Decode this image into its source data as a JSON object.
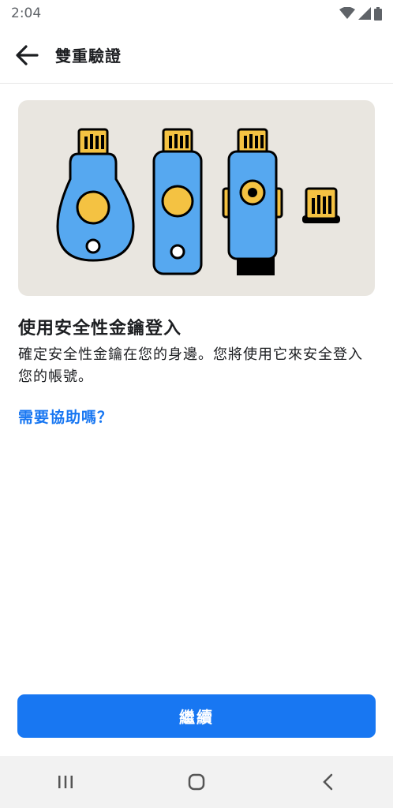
{
  "status_bar": {
    "time": "2:04"
  },
  "app_bar": {
    "title": "雙重驗證",
    "back_icon": "arrow-left-icon"
  },
  "illustration": {
    "description_icon": "security-keys-illustration"
  },
  "content": {
    "heading": "使用安全性金鑰登入",
    "body": "確定安全性金鑰在您的身邊。您將使用它來安全登入您的帳號。",
    "help_link": "需要協助嗎？"
  },
  "actions": {
    "continue_label": "繼續"
  },
  "colors": {
    "accent": "#1877f2",
    "hero_bg": "#e9e6e0",
    "key_blue": "#56a8f0",
    "key_gold": "#f4c242"
  }
}
